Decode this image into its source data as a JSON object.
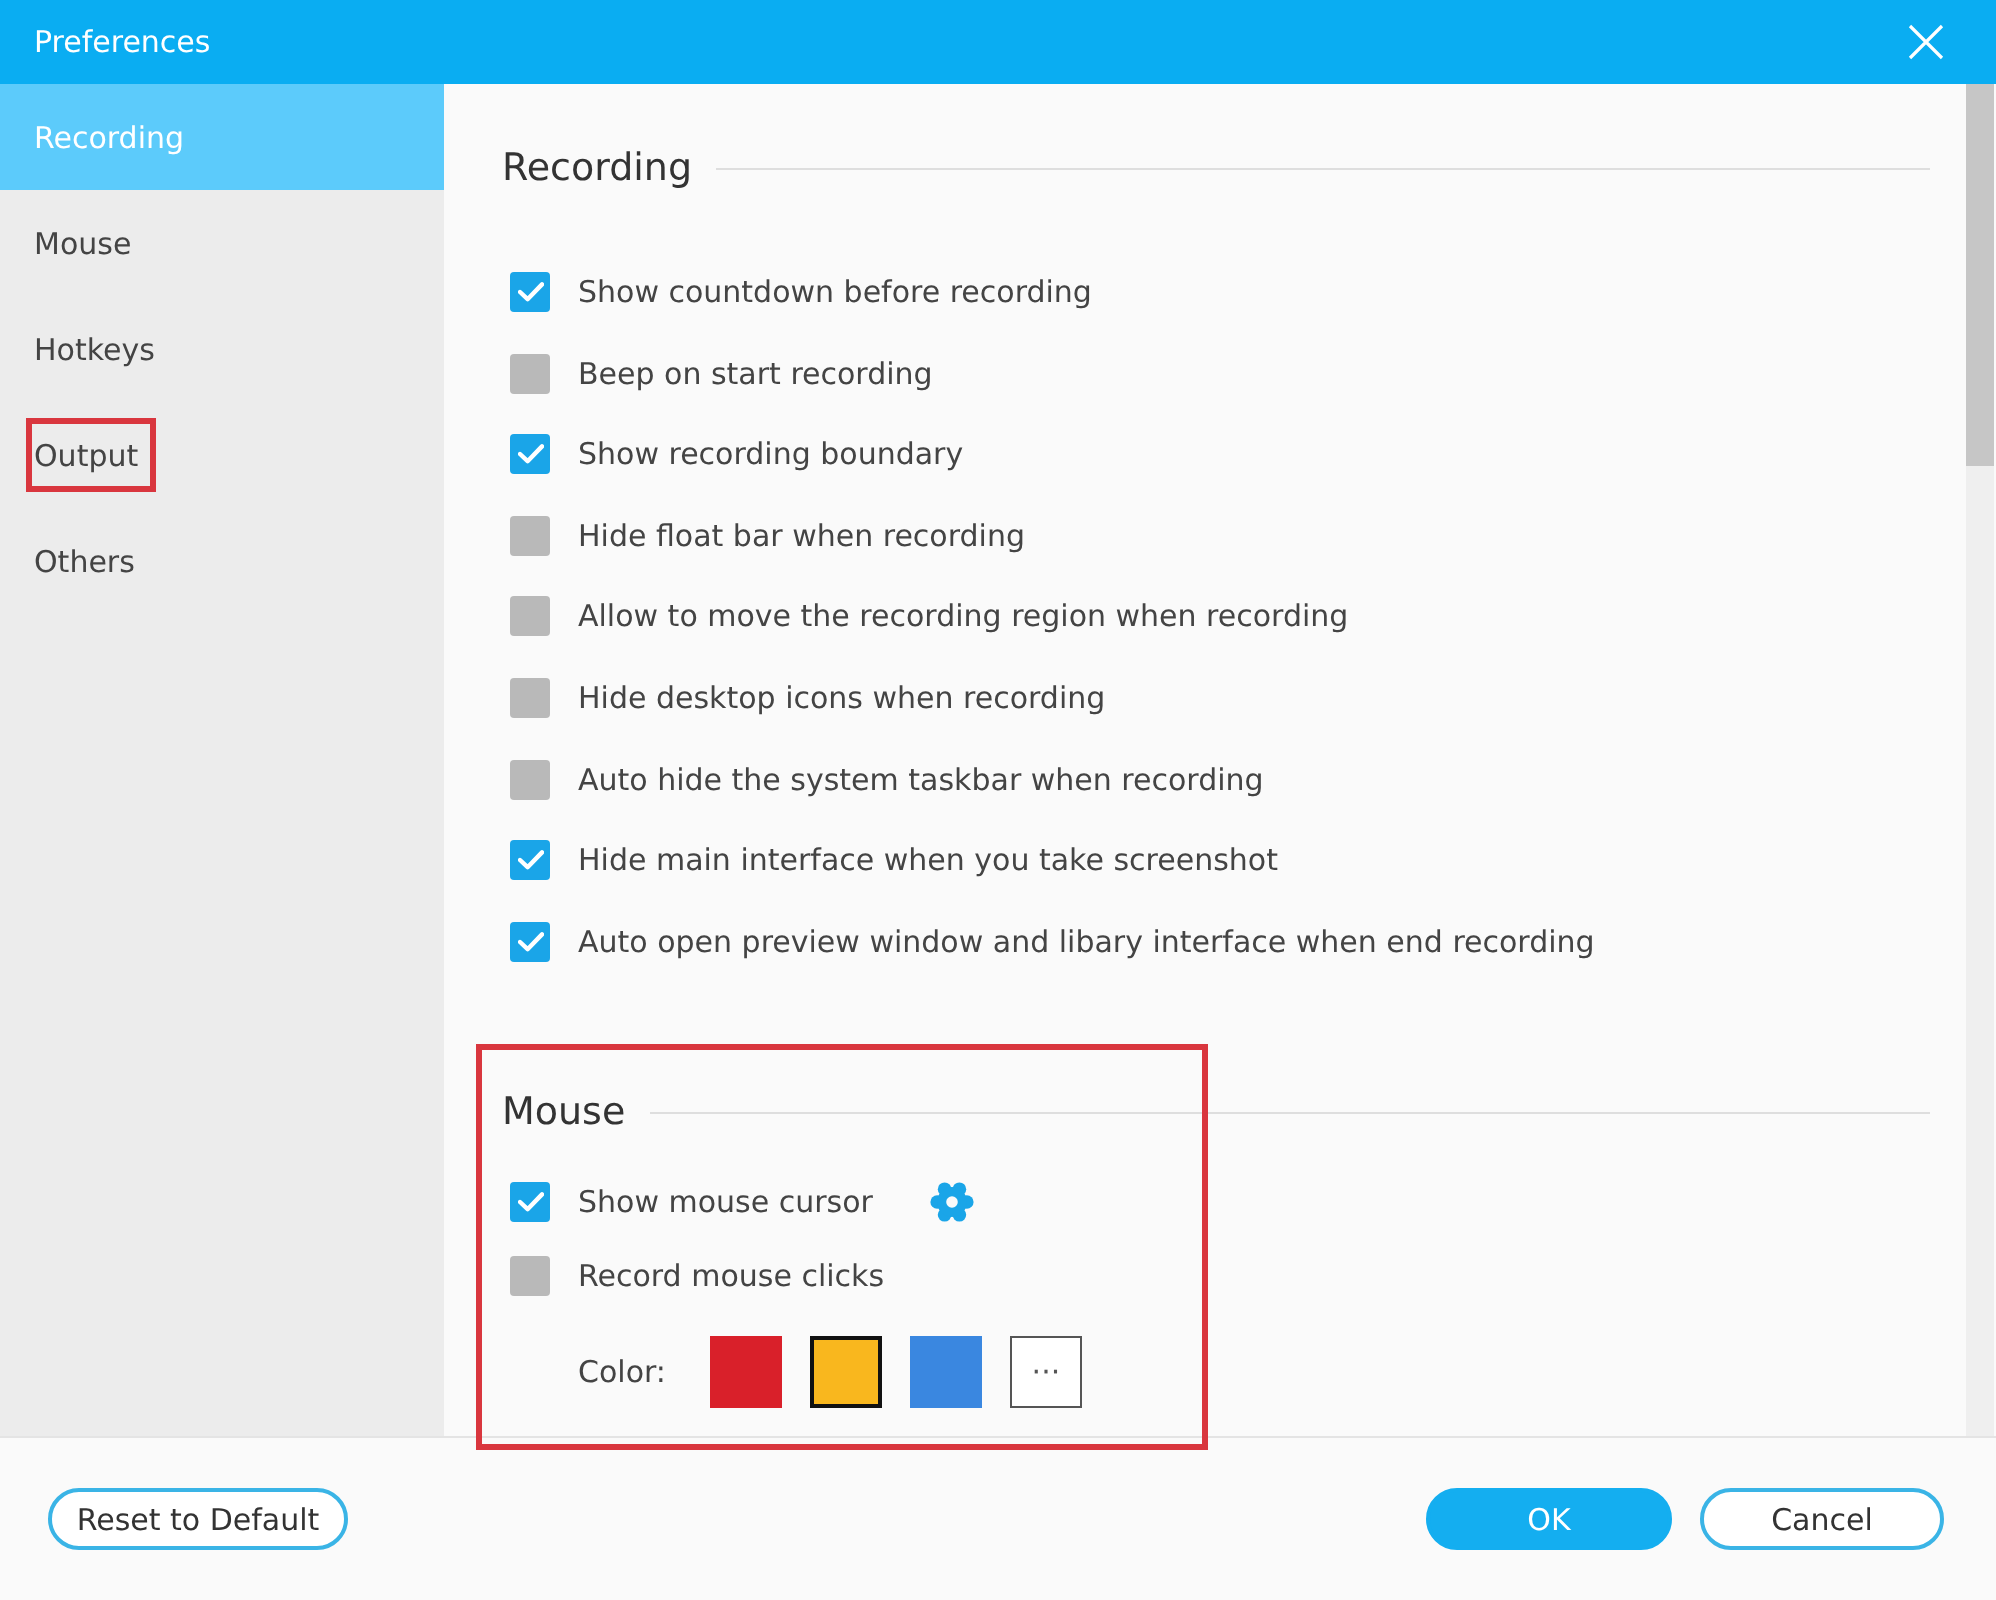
{
  "window": {
    "title": "Preferences"
  },
  "sidebar": {
    "items": [
      {
        "label": "Recording",
        "selected": true,
        "annotated": false
      },
      {
        "label": "Mouse",
        "selected": false,
        "annotated": false
      },
      {
        "label": "Hotkeys",
        "selected": false,
        "annotated": false
      },
      {
        "label": "Output",
        "selected": false,
        "annotated": true
      },
      {
        "label": "Others",
        "selected": false,
        "annotated": false
      }
    ]
  },
  "sections": [
    {
      "title": "Recording",
      "annotated": false,
      "options": [
        {
          "kind": "checkbox",
          "label": "Show countdown before recording",
          "checked": true,
          "gear": false
        },
        {
          "kind": "checkbox",
          "label": "Beep on start recording",
          "checked": false,
          "gear": false
        },
        {
          "kind": "checkbox",
          "label": "Show recording boundary",
          "checked": true,
          "gear": false
        },
        {
          "kind": "checkbox",
          "label": "Hide float bar when recording",
          "checked": false,
          "gear": false
        },
        {
          "kind": "checkbox",
          "label": "Allow to move the recording region when recording",
          "checked": false,
          "gear": false
        },
        {
          "kind": "checkbox",
          "label": "Hide desktop icons when recording",
          "checked": false,
          "gear": false
        },
        {
          "kind": "checkbox",
          "label": "Auto hide the system taskbar when recording",
          "checked": false,
          "gear": false
        },
        {
          "kind": "checkbox",
          "label": "Hide main interface when you take screenshot",
          "checked": true,
          "gear": false
        },
        {
          "kind": "checkbox",
          "label": "Auto open preview window and libary interface when end recording",
          "checked": true,
          "gear": false
        }
      ]
    },
    {
      "title": "Mouse",
      "annotated": true,
      "options": [
        {
          "kind": "checkbox",
          "label": "Show mouse cursor",
          "checked": true,
          "gear": true
        },
        {
          "kind": "checkbox",
          "label": "Record mouse clicks",
          "checked": false,
          "gear": false
        },
        {
          "kind": "colors",
          "label": "Color:",
          "swatches": [
            {
              "color": "#d9202a",
              "selected": false
            },
            {
              "color": "#f9b71e",
              "selected": true
            },
            {
              "color": "#3a87e0",
              "selected": false
            }
          ],
          "more_label": "···"
        }
      ]
    }
  ],
  "buttons": [
    {
      "kind": "reset",
      "label": "Reset to Default"
    },
    {
      "kind": "confirm",
      "label": "OK"
    },
    {
      "kind": "cancel",
      "label": "Cancel"
    }
  ]
}
